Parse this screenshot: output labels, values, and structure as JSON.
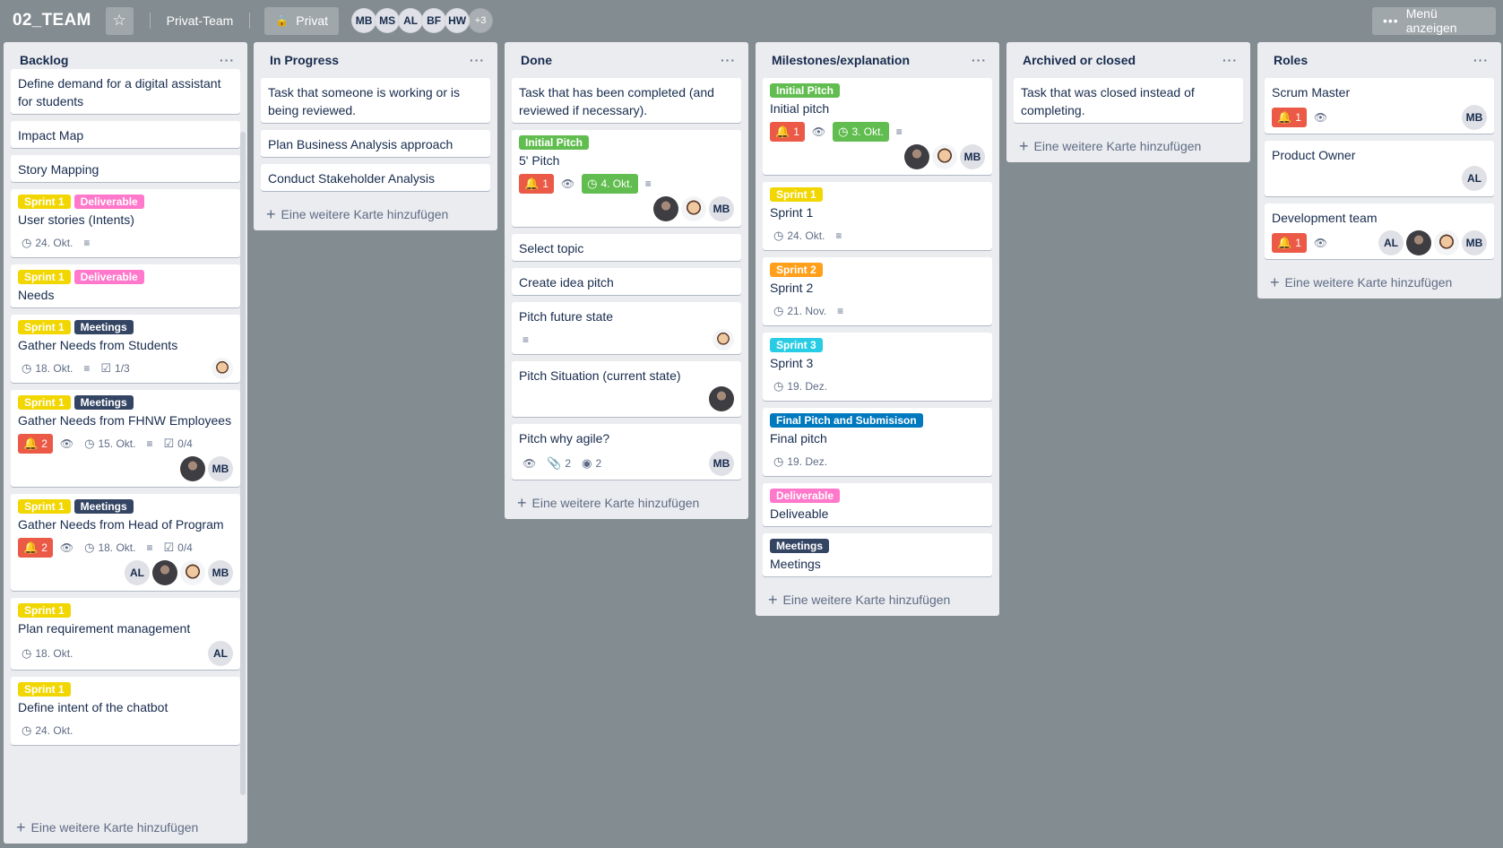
{
  "header": {
    "board_title": "02_TEAM",
    "team": "Privat-Team",
    "visibility": "Privat",
    "members": [
      "MB",
      "MS",
      "AL",
      "BF",
      "HW"
    ],
    "more_members": "+3",
    "menu_label": "Menü anzeigen",
    "star_icon": "star-icon",
    "lock_icon": "lock-icon"
  },
  "add_card_label": "Eine weitere Karte hinzufügen",
  "lists": [
    {
      "title": "Backlog",
      "cards": [
        {
          "title": "Define demand for a digital assistant for students"
        },
        {
          "title": "Impact Map"
        },
        {
          "title": "Story Mapping"
        },
        {
          "labels": [
            "Sprint 1",
            "Deliverable"
          ],
          "title": "User stories (Intents)",
          "due": "24. Okt."
        },
        {
          "labels": [
            "Sprint 1",
            "Deliverable"
          ],
          "title": "Needs"
        },
        {
          "labels": [
            "Sprint 1",
            "Meetings"
          ],
          "title": "Gather Needs from Students",
          "due": "18. Okt.",
          "checklist": "1/3"
        },
        {
          "labels": [
            "Sprint 1",
            "Meetings"
          ],
          "title": "Gather Needs from FHNW Employees",
          "notifications": "2",
          "due": "15. Okt.",
          "checklist": "0/4",
          "avatars": [
            "MB"
          ]
        },
        {
          "labels": [
            "Sprint 1",
            "Meetings"
          ],
          "title": "Gather Needs from Head of Program",
          "notifications": "2",
          "due": "18. Okt.",
          "checklist": "0/4",
          "avatars": [
            "AL",
            "MB"
          ]
        },
        {
          "labels": [
            "Sprint 1"
          ],
          "title": "Plan requirement management",
          "due": "18. Okt.",
          "avatars": [
            "AL"
          ]
        },
        {
          "labels": [
            "Sprint 1"
          ],
          "title": "Define intent of the chatbot",
          "due": "24. Okt."
        }
      ]
    },
    {
      "title": "In Progress",
      "cards": [
        {
          "title": "Task that someone is working or is being reviewed."
        },
        {
          "title": "Plan Business Analysis approach"
        },
        {
          "title": "Conduct Stakeholder Analysis"
        }
      ]
    },
    {
      "title": "Done",
      "cards": [
        {
          "title": "Task that has been completed (and reviewed if necessary)."
        },
        {
          "labels": [
            "Initial Pitch"
          ],
          "title": "5' Pitch",
          "notifications": "1",
          "due": "4. Okt.",
          "avatars": [
            "MB"
          ]
        },
        {
          "title": "Select topic"
        },
        {
          "title": "Create idea pitch"
        },
        {
          "title": "Pitch future state"
        },
        {
          "title": "Pitch Situation (current state)"
        },
        {
          "title": "Pitch why agile?",
          "attachments": "2",
          "github": "2",
          "avatars": [
            "MB"
          ]
        }
      ]
    },
    {
      "title": "Milestones/explanation",
      "cards": [
        {
          "labels": [
            "Initial Pitch"
          ],
          "title": "Initial pitch",
          "notifications": "1",
          "due": "3. Okt.",
          "avatars": [
            "MB"
          ]
        },
        {
          "labels": [
            "Sprint 1"
          ],
          "title": "Sprint 1",
          "due": "24. Okt."
        },
        {
          "labels": [
            "Sprint 2"
          ],
          "title": "Sprint 2",
          "due": "21. Nov."
        },
        {
          "labels": [
            "Sprint 3"
          ],
          "title": "Sprint 3",
          "due": "19. Dez."
        },
        {
          "labels": [
            "Final Pitch and Submisison"
          ],
          "title": "Final pitch",
          "due": "19. Dez."
        },
        {
          "labels": [
            "Deliverable"
          ],
          "title": "Deliveable"
        },
        {
          "labels": [
            "Meetings"
          ],
          "title": "Meetings"
        }
      ]
    },
    {
      "title": "Archived or closed",
      "cards": [
        {
          "title": "Task that was closed instead of completing."
        }
      ]
    },
    {
      "title": "Roles",
      "cards": [
        {
          "title": "Scrum Master",
          "notifications": "1",
          "avatars": [
            "MB"
          ]
        },
        {
          "title": "Product Owner",
          "avatars": [
            "AL"
          ]
        },
        {
          "title": "Development team",
          "notifications": "1",
          "avatars": [
            "AL",
            "MB"
          ]
        }
      ]
    }
  ]
}
